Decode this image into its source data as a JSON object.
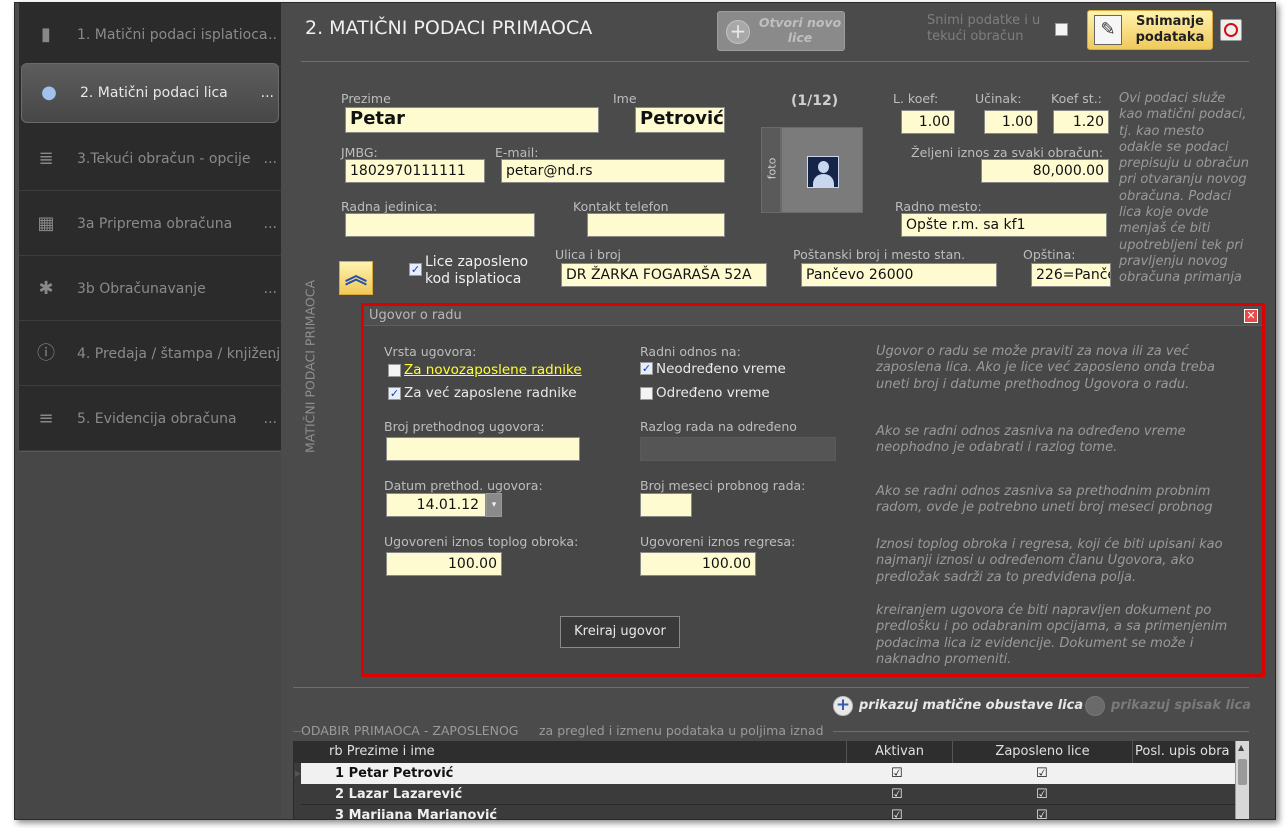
{
  "sidebar": {
    "items": [
      {
        "label": "1. Matični podaci isplatioca",
        "dots": "...",
        "icon": "pillar-icon"
      },
      {
        "label": "2. Matični podaci lica",
        "dots": "...",
        "icon": "user-icon"
      },
      {
        "label": "3.Tekući obračun - opcije",
        "dots": "...",
        "icon": "coins-check-icon"
      },
      {
        "label": "3a Priprema obračuna",
        "dots": "...",
        "icon": "calculator-icon"
      },
      {
        "label": "3b Obračunavanje",
        "dots": "...",
        "icon": "coins-gear-icon"
      },
      {
        "label": "4. Predaja / štampa / knjiženj...",
        "dots": "...",
        "icon": "coins-info-icon"
      },
      {
        "label": "5. Evidencija obračuna",
        "dots": "...",
        "icon": "coins-stack-icon"
      }
    ]
  },
  "header": {
    "title": "2. MATIČNI PODACI PRIMAOCA",
    "new_person_label": "Otvori novo lice",
    "save_current_label": "Snimi podatke i u tekući obračun",
    "save_label": "Snimanje podataka"
  },
  "vertical_label": "MATIČNI PODACI PRIMAOCA",
  "person": {
    "prezime_label": "Prezime",
    "prezime": "Petar",
    "ime_label": "Ime",
    "ime": "Petrović",
    "counter": "(1/12)",
    "jmbg_label": "JMBG:",
    "jmbg": "1802970111111",
    "email_label": "E-mail:",
    "email": "petar@nd.rs",
    "foto_label": "foto",
    "radna_jedinica_label": "Radna jedinica:",
    "radna_jedinica": "",
    "kontakt_label": "Kontakt telefon",
    "kontakt": "",
    "lkoef_label": "L. koef:",
    "lkoef": "1.00",
    "ucinak_label": "Učinak:",
    "ucinak": "1.00",
    "koefst_label": "Koef st.:",
    "koefst": "1.20",
    "zeljeni_label": "Željeni iznos za svaki obračun:",
    "zeljeni": "80,000.00",
    "radno_mesto_label": "Radno mesto:",
    "radno_mesto": "Opšte r.m. sa kf1",
    "zaposleno_label": "Lice zaposleno kod isplatioca",
    "ulica_label": "Ulica i broj",
    "ulica": "DR ŽARKA FOGARAŠA 52A",
    "postanski_label": "Poštanski broj i mesto stan.",
    "postanski": "Pančevo 26000",
    "opstina_label": "Opština:",
    "opstina": "226=Panče",
    "info_note": "Ovi podaci služe kao matični podaci, tj. kao mesto odakle se podaci prepisuju u obračun pri otvaranju novog obračuna. Podaci lica koje ovde menjaš će biti upotrebljeni tek pri pravljenju novog obračuna primanja"
  },
  "dialog": {
    "title": "Ugovor o radu",
    "vrsta_label": "Vrsta ugovora:",
    "opt_novo": "Za novozaposlene radnike",
    "opt_vec": "Za već zaposlene radnike",
    "radni_odnos_label": "Radni odnos na:",
    "opt_neodredjeno": "Neodređeno vreme",
    "opt_odredjeno": "Određeno vreme",
    "broj_prethodnog_label": "Broj prethodnog ugovora:",
    "broj_prethodnog": "",
    "razlog_label": "Razlog rada na određeno",
    "datum_label": "Datum prethod. ugovora:",
    "datum": "14.01.12",
    "probni_label": "Broj meseci probnog rada:",
    "probni": "",
    "topli_label": "Ugovoreni iznos toplog obroka:",
    "topli": "100.00",
    "regres_label": "Ugovoreni iznos regresa:",
    "regres": "100.00",
    "create_label": "Kreiraj ugovor",
    "note1": "Ugovor o radu se može praviti za nova ili za već zaposlena lica. Ako je lice već zaposleno onda treba uneti broj i datume prethodnog Ugovora o radu.",
    "note2": "Ako se radni odnos zasniva na određeno vreme neophodno je odabrati i razlog tome.",
    "note3": "Ako se radni odnos zasniva sa prethodnim probnim radom, ovde je potrebno uneti broj meseci probnog",
    "note4": "Iznosi toplog obroka i regresa, koji će biti upisani kao najmanji iznosi u određenom članu Ugovora, ako predložak sadrži za to predviđena polja.",
    "note5": "kreiranjem ugovora će biti napravljen dokument po predlošku i po odabranim opcijama, a sa primenjenim podacima lica iz evidencije. Dokument se može i naknadno promeniti."
  },
  "bottom": {
    "obustave_label": "prikazuj matične obustave lica",
    "spisak_label": "prikazuj spisak lica",
    "section_title": "ODABIR PRIMAOCA - ZAPOSLENOG",
    "section_sub": "za pregled i izmenu podataka u poljima iznad"
  },
  "table": {
    "headers": [
      "rb Prezime i ime",
      "Aktivan",
      "Zaposleno lice",
      "Posl. upis obra"
    ],
    "rows": [
      {
        "name": "1 Petar Petrović",
        "aktivan": "☑",
        "zaposleno": "☑"
      },
      {
        "name": "2 Lazar Lazarević",
        "aktivan": "☑",
        "zaposleno": "☑"
      },
      {
        "name": "3 Marijana Marjanović",
        "aktivan": "☑",
        "zaposleno": "☑"
      }
    ]
  }
}
